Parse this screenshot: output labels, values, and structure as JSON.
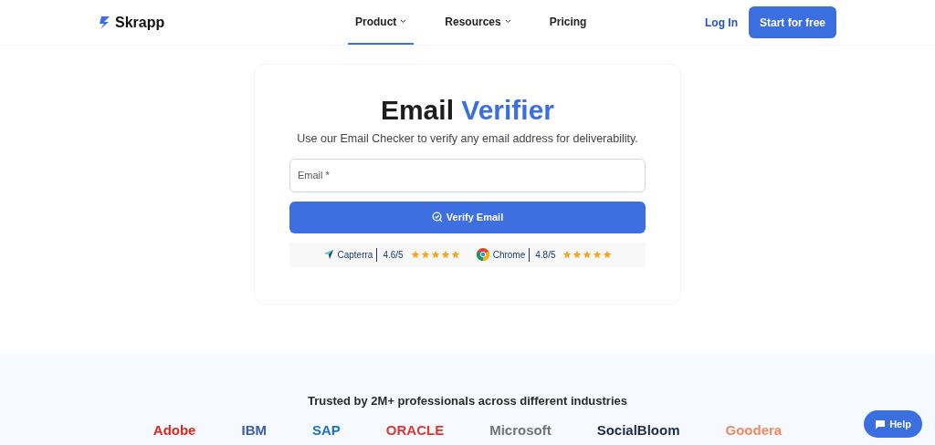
{
  "nav": {
    "logo": "Skrapp",
    "items": [
      {
        "label": "Product",
        "selected": true,
        "dropdown": true
      },
      {
        "label": "Resources",
        "selected": false,
        "dropdown": true
      },
      {
        "label": "Pricing",
        "selected": false,
        "dropdown": false
      }
    ],
    "login": "Log In",
    "cta": "Start for free"
  },
  "hero": {
    "title": "Email **Verifier**",
    "subtitle": "Use our Email Checker to verify any email address for deliverability.",
    "email_field": {
      "placeholder": "Email *"
    },
    "button": "Verify Email",
    "ratings": [
      {
        "kind": "capterra",
        "name": "Capterra",
        "score": "4.6/5",
        "stars": 5
      },
      {
        "kind": "chrome",
        "name": "Chrome",
        "score": "4.8/5",
        "stars": 5
      }
    ]
  },
  "trusted": {
    "heading": "Trusted by 2M+ professionals across different industries",
    "logos": [
      {
        "name": "Adobe",
        "color": "#e1251b"
      },
      {
        "name": "IBM",
        "color": "#3b5ea8"
      },
      {
        "name": "SAP",
        "color": "#1a73c8"
      },
      {
        "name": "ORACLE",
        "color": "#e2362f"
      },
      {
        "name": "Microsoft",
        "color": "#737373"
      },
      {
        "name": "SocialBloom",
        "color": "#1e2a4a"
      },
      {
        "name": "Goodera",
        "color": "#f08a5d"
      }
    ]
  },
  "help": "Help"
}
